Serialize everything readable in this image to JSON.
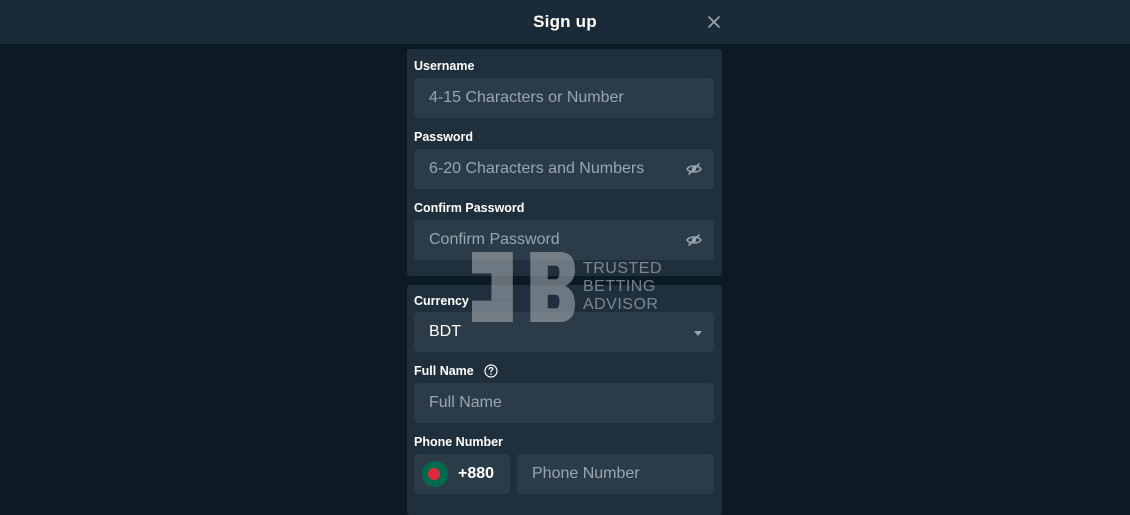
{
  "header": {
    "title": "Sign up"
  },
  "form": {
    "username": {
      "label": "Username",
      "placeholder": "4-15 Characters or Number"
    },
    "password": {
      "label": "Password",
      "placeholder": "6-20 Characters and Numbers"
    },
    "confirm_password": {
      "label": "Confirm Password",
      "placeholder": "Confirm Password"
    },
    "currency": {
      "label": "Currency",
      "value": "BDT"
    },
    "full_name": {
      "label": "Full Name",
      "placeholder": "Full Name"
    },
    "phone": {
      "label": "Phone Number",
      "country_code": "+880",
      "placeholder": "Phone Number"
    }
  },
  "watermark": {
    "line1": "TRUSTED",
    "line2": "BETTING",
    "line3": "ADVISOR"
  },
  "icons": {
    "close": "close-icon",
    "eye": "eye-slash-icon",
    "help": "question-circle-icon",
    "dropdown": "caret-down-icon",
    "flag": "bangladesh-flag-icon"
  },
  "colors": {
    "page_bg": "#0c1a24",
    "header_bg": "#1a2a36",
    "panel_bg": "#1f2f3b",
    "input_bg": "#2b3b48",
    "placeholder": "#9aa6b0"
  }
}
